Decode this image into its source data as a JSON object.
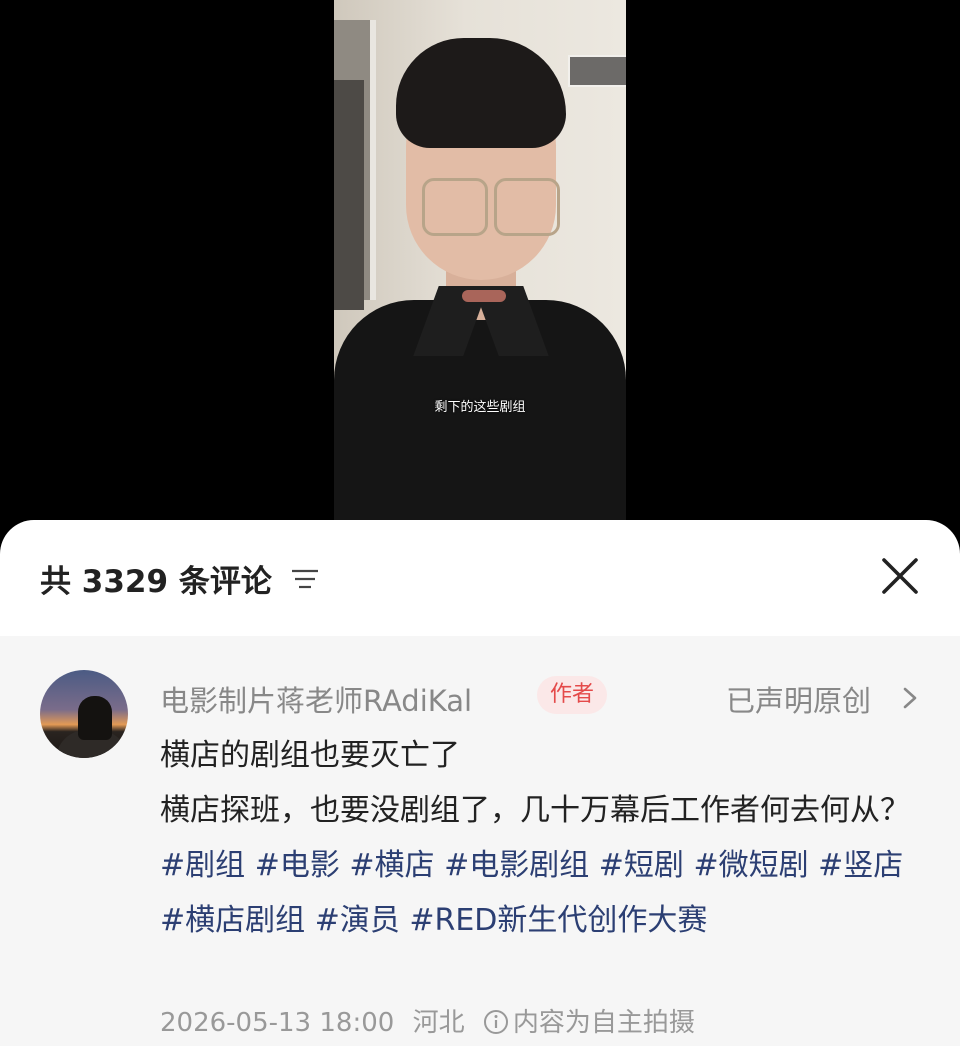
{
  "video": {
    "subtitle": "剩下的这些剧组"
  },
  "comments_sheet": {
    "title": "共 3329 条评论",
    "sort_icon": "sort-lines-icon",
    "close_icon": "close-icon"
  },
  "comment": {
    "author": "电影制片蒋老师RAdiKal",
    "author_badge": "作者",
    "original_label": "已声明原创",
    "title": "横店的剧组也要灭亡了",
    "body_text": "横店探班，也要没剧组了，几十万幕后工作者何去何从？",
    "hashtags": [
      "#剧组",
      "#电影",
      "#横店",
      "#电影剧组",
      "#短剧",
      "#微短剧",
      "#竖店",
      "#横店剧组",
      "#演员",
      "#RED新生代创作大赛"
    ],
    "date": "2026-05-13 18:00",
    "location": "河北",
    "disclaimer": "内容为自主拍摄"
  },
  "colors": {
    "badge_bg": "#fbe8e8",
    "badge_text": "#e44a4a",
    "tag_color": "#2c3f73",
    "panel_bg": "#f6f6f6"
  }
}
